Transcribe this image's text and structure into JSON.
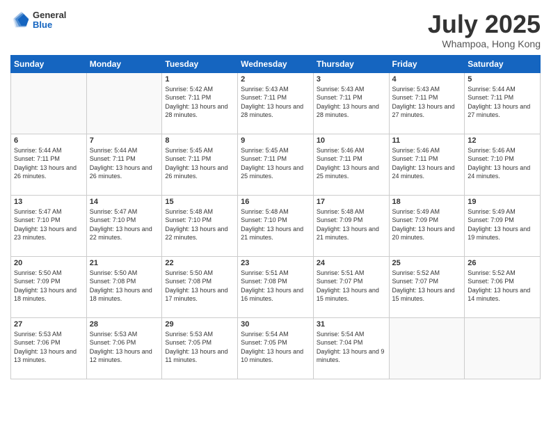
{
  "header": {
    "logo": {
      "general": "General",
      "blue": "Blue"
    },
    "month": "July 2025",
    "location": "Whampoa, Hong Kong"
  },
  "weekdays": [
    "Sunday",
    "Monday",
    "Tuesday",
    "Wednesday",
    "Thursday",
    "Friday",
    "Saturday"
  ],
  "weeks": [
    [
      {
        "day": "",
        "empty": true
      },
      {
        "day": "",
        "empty": true
      },
      {
        "day": "1",
        "sunrise": "Sunrise: 5:42 AM",
        "sunset": "Sunset: 7:11 PM",
        "daylight": "Daylight: 13 hours and 28 minutes."
      },
      {
        "day": "2",
        "sunrise": "Sunrise: 5:43 AM",
        "sunset": "Sunset: 7:11 PM",
        "daylight": "Daylight: 13 hours and 28 minutes."
      },
      {
        "day": "3",
        "sunrise": "Sunrise: 5:43 AM",
        "sunset": "Sunset: 7:11 PM",
        "daylight": "Daylight: 13 hours and 28 minutes."
      },
      {
        "day": "4",
        "sunrise": "Sunrise: 5:43 AM",
        "sunset": "Sunset: 7:11 PM",
        "daylight": "Daylight: 13 hours and 27 minutes."
      },
      {
        "day": "5",
        "sunrise": "Sunrise: 5:44 AM",
        "sunset": "Sunset: 7:11 PM",
        "daylight": "Daylight: 13 hours and 27 minutes."
      }
    ],
    [
      {
        "day": "6",
        "sunrise": "Sunrise: 5:44 AM",
        "sunset": "Sunset: 7:11 PM",
        "daylight": "Daylight: 13 hours and 26 minutes."
      },
      {
        "day": "7",
        "sunrise": "Sunrise: 5:44 AM",
        "sunset": "Sunset: 7:11 PM",
        "daylight": "Daylight: 13 hours and 26 minutes."
      },
      {
        "day": "8",
        "sunrise": "Sunrise: 5:45 AM",
        "sunset": "Sunset: 7:11 PM",
        "daylight": "Daylight: 13 hours and 26 minutes."
      },
      {
        "day": "9",
        "sunrise": "Sunrise: 5:45 AM",
        "sunset": "Sunset: 7:11 PM",
        "daylight": "Daylight: 13 hours and 25 minutes."
      },
      {
        "day": "10",
        "sunrise": "Sunrise: 5:46 AM",
        "sunset": "Sunset: 7:11 PM",
        "daylight": "Daylight: 13 hours and 25 minutes."
      },
      {
        "day": "11",
        "sunrise": "Sunrise: 5:46 AM",
        "sunset": "Sunset: 7:11 PM",
        "daylight": "Daylight: 13 hours and 24 minutes."
      },
      {
        "day": "12",
        "sunrise": "Sunrise: 5:46 AM",
        "sunset": "Sunset: 7:10 PM",
        "daylight": "Daylight: 13 hours and 24 minutes."
      }
    ],
    [
      {
        "day": "13",
        "sunrise": "Sunrise: 5:47 AM",
        "sunset": "Sunset: 7:10 PM",
        "daylight": "Daylight: 13 hours and 23 minutes."
      },
      {
        "day": "14",
        "sunrise": "Sunrise: 5:47 AM",
        "sunset": "Sunset: 7:10 PM",
        "daylight": "Daylight: 13 hours and 22 minutes."
      },
      {
        "day": "15",
        "sunrise": "Sunrise: 5:48 AM",
        "sunset": "Sunset: 7:10 PM",
        "daylight": "Daylight: 13 hours and 22 minutes."
      },
      {
        "day": "16",
        "sunrise": "Sunrise: 5:48 AM",
        "sunset": "Sunset: 7:10 PM",
        "daylight": "Daylight: 13 hours and 21 minutes."
      },
      {
        "day": "17",
        "sunrise": "Sunrise: 5:48 AM",
        "sunset": "Sunset: 7:09 PM",
        "daylight": "Daylight: 13 hours and 21 minutes."
      },
      {
        "day": "18",
        "sunrise": "Sunrise: 5:49 AM",
        "sunset": "Sunset: 7:09 PM",
        "daylight": "Daylight: 13 hours and 20 minutes."
      },
      {
        "day": "19",
        "sunrise": "Sunrise: 5:49 AM",
        "sunset": "Sunset: 7:09 PM",
        "daylight": "Daylight: 13 hours and 19 minutes."
      }
    ],
    [
      {
        "day": "20",
        "sunrise": "Sunrise: 5:50 AM",
        "sunset": "Sunset: 7:09 PM",
        "daylight": "Daylight: 13 hours and 18 minutes."
      },
      {
        "day": "21",
        "sunrise": "Sunrise: 5:50 AM",
        "sunset": "Sunset: 7:08 PM",
        "daylight": "Daylight: 13 hours and 18 minutes."
      },
      {
        "day": "22",
        "sunrise": "Sunrise: 5:50 AM",
        "sunset": "Sunset: 7:08 PM",
        "daylight": "Daylight: 13 hours and 17 minutes."
      },
      {
        "day": "23",
        "sunrise": "Sunrise: 5:51 AM",
        "sunset": "Sunset: 7:08 PM",
        "daylight": "Daylight: 13 hours and 16 minutes."
      },
      {
        "day": "24",
        "sunrise": "Sunrise: 5:51 AM",
        "sunset": "Sunset: 7:07 PM",
        "daylight": "Daylight: 13 hours and 15 minutes."
      },
      {
        "day": "25",
        "sunrise": "Sunrise: 5:52 AM",
        "sunset": "Sunset: 7:07 PM",
        "daylight": "Daylight: 13 hours and 15 minutes."
      },
      {
        "day": "26",
        "sunrise": "Sunrise: 5:52 AM",
        "sunset": "Sunset: 7:06 PM",
        "daylight": "Daylight: 13 hours and 14 minutes."
      }
    ],
    [
      {
        "day": "27",
        "sunrise": "Sunrise: 5:53 AM",
        "sunset": "Sunset: 7:06 PM",
        "daylight": "Daylight: 13 hours and 13 minutes."
      },
      {
        "day": "28",
        "sunrise": "Sunrise: 5:53 AM",
        "sunset": "Sunset: 7:06 PM",
        "daylight": "Daylight: 13 hours and 12 minutes."
      },
      {
        "day": "29",
        "sunrise": "Sunrise: 5:53 AM",
        "sunset": "Sunset: 7:05 PM",
        "daylight": "Daylight: 13 hours and 11 minutes."
      },
      {
        "day": "30",
        "sunrise": "Sunrise: 5:54 AM",
        "sunset": "Sunset: 7:05 PM",
        "daylight": "Daylight: 13 hours and 10 minutes."
      },
      {
        "day": "31",
        "sunrise": "Sunrise: 5:54 AM",
        "sunset": "Sunset: 7:04 PM",
        "daylight": "Daylight: 13 hours and 9 minutes."
      },
      {
        "day": "",
        "empty": true
      },
      {
        "day": "",
        "empty": true
      }
    ]
  ]
}
